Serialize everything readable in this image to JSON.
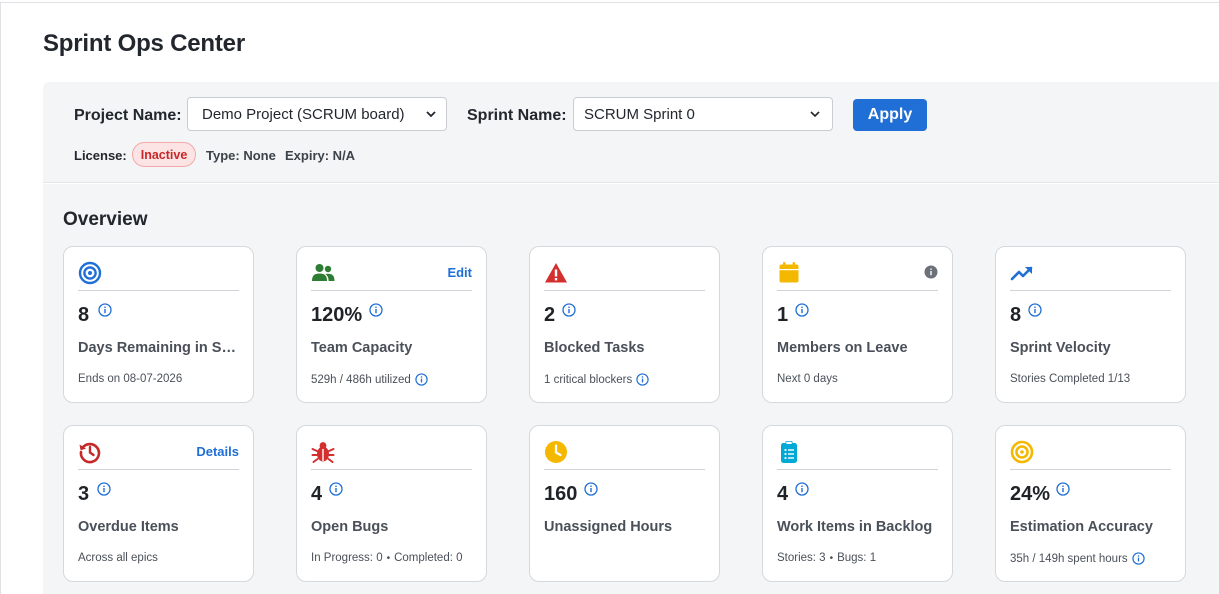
{
  "page": {
    "title": "Sprint Ops Center"
  },
  "filters": {
    "project_label": "Project Name:",
    "project_value": "Demo Project (SCRUM board)",
    "sprint_label": "Sprint Name:",
    "sprint_value": "SCRUM Sprint 0",
    "apply_label": "Apply"
  },
  "license": {
    "label": "License:",
    "status": "Inactive",
    "type": "Type: None",
    "expiry": "Expiry: N/A"
  },
  "overview": {
    "title": "Overview",
    "cards": [
      {
        "icon": "target-icon",
        "value": "8",
        "label": "Days Remaining in Sprint",
        "sub": "Ends on 08-07-2026"
      },
      {
        "icon": "team-icon",
        "value": "120%",
        "label": "Team Capacity",
        "sub": "529h / 486h utilized",
        "link": "Edit"
      },
      {
        "icon": "warning-icon",
        "value": "2",
        "label": "Blocked Tasks",
        "sub": "1 critical blockers"
      },
      {
        "icon": "calendar-icon",
        "value": "1",
        "label": "Members on Leave",
        "sub": "Next 0 days"
      },
      {
        "icon": "trend-up-icon",
        "value": "8",
        "label": "Sprint Velocity",
        "sub": "Stories Completed 1/13"
      },
      {
        "icon": "history-icon",
        "value": "3",
        "label": "Overdue Items",
        "sub": "Across all epics",
        "link": "Details"
      },
      {
        "icon": "bug-icon",
        "value": "4",
        "label": "Open Bugs",
        "sub_a": "In Progress: 0",
        "sub_b": "Completed: 0"
      },
      {
        "icon": "clock-icon",
        "value": "160",
        "label": "Unassigned Hours",
        "sub": ""
      },
      {
        "icon": "clipboard-icon",
        "value": "4",
        "label": "Work Items in Backlog",
        "sub_a": "Stories: 3",
        "sub_b": "Bugs: 1"
      },
      {
        "icon": "bullseye-icon",
        "value": "24%",
        "label": "Estimation Accuracy",
        "sub": "35h / 149h spent hours"
      }
    ]
  },
  "colors": {
    "accent": "#1f6fd6",
    "danger": "#c62828",
    "warning": "#f5b800",
    "success": "#2e7d32",
    "cyan": "#00a9d6"
  },
  "separator": "•"
}
